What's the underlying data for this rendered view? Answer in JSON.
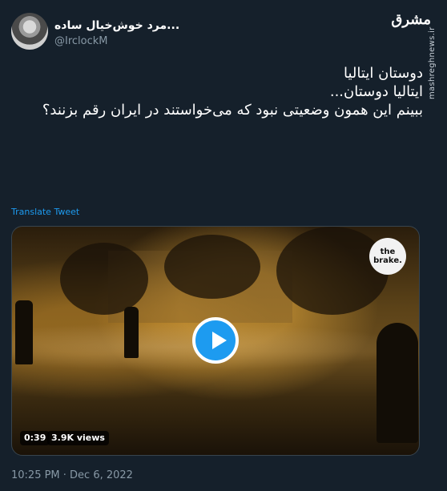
{
  "author": {
    "display_name": "...مرد خوش‌خیال ساده",
    "handle": "@IrclockM"
  },
  "branding": {
    "site_logo": "مشرق",
    "watermark": "mashreghnews.ir"
  },
  "tweet": {
    "lines": [
      "دوستان ایتالیا",
      "ایتالیا دوستان...",
      "ببینم این همون وضعیتی نبود که می‌خواستند در ایران رقم بزنند؟"
    ],
    "translate_label": "Translate Tweet",
    "timestamp": "10:25 PM · Dec 6, 2022"
  },
  "media": {
    "badge_text": "the brake.",
    "duration": "0:39",
    "views": "3.9K views",
    "play_icon": "play-icon"
  },
  "colors": {
    "background": "#15202b",
    "accent": "#1d9bf0",
    "secondary_text": "#8899a6"
  }
}
